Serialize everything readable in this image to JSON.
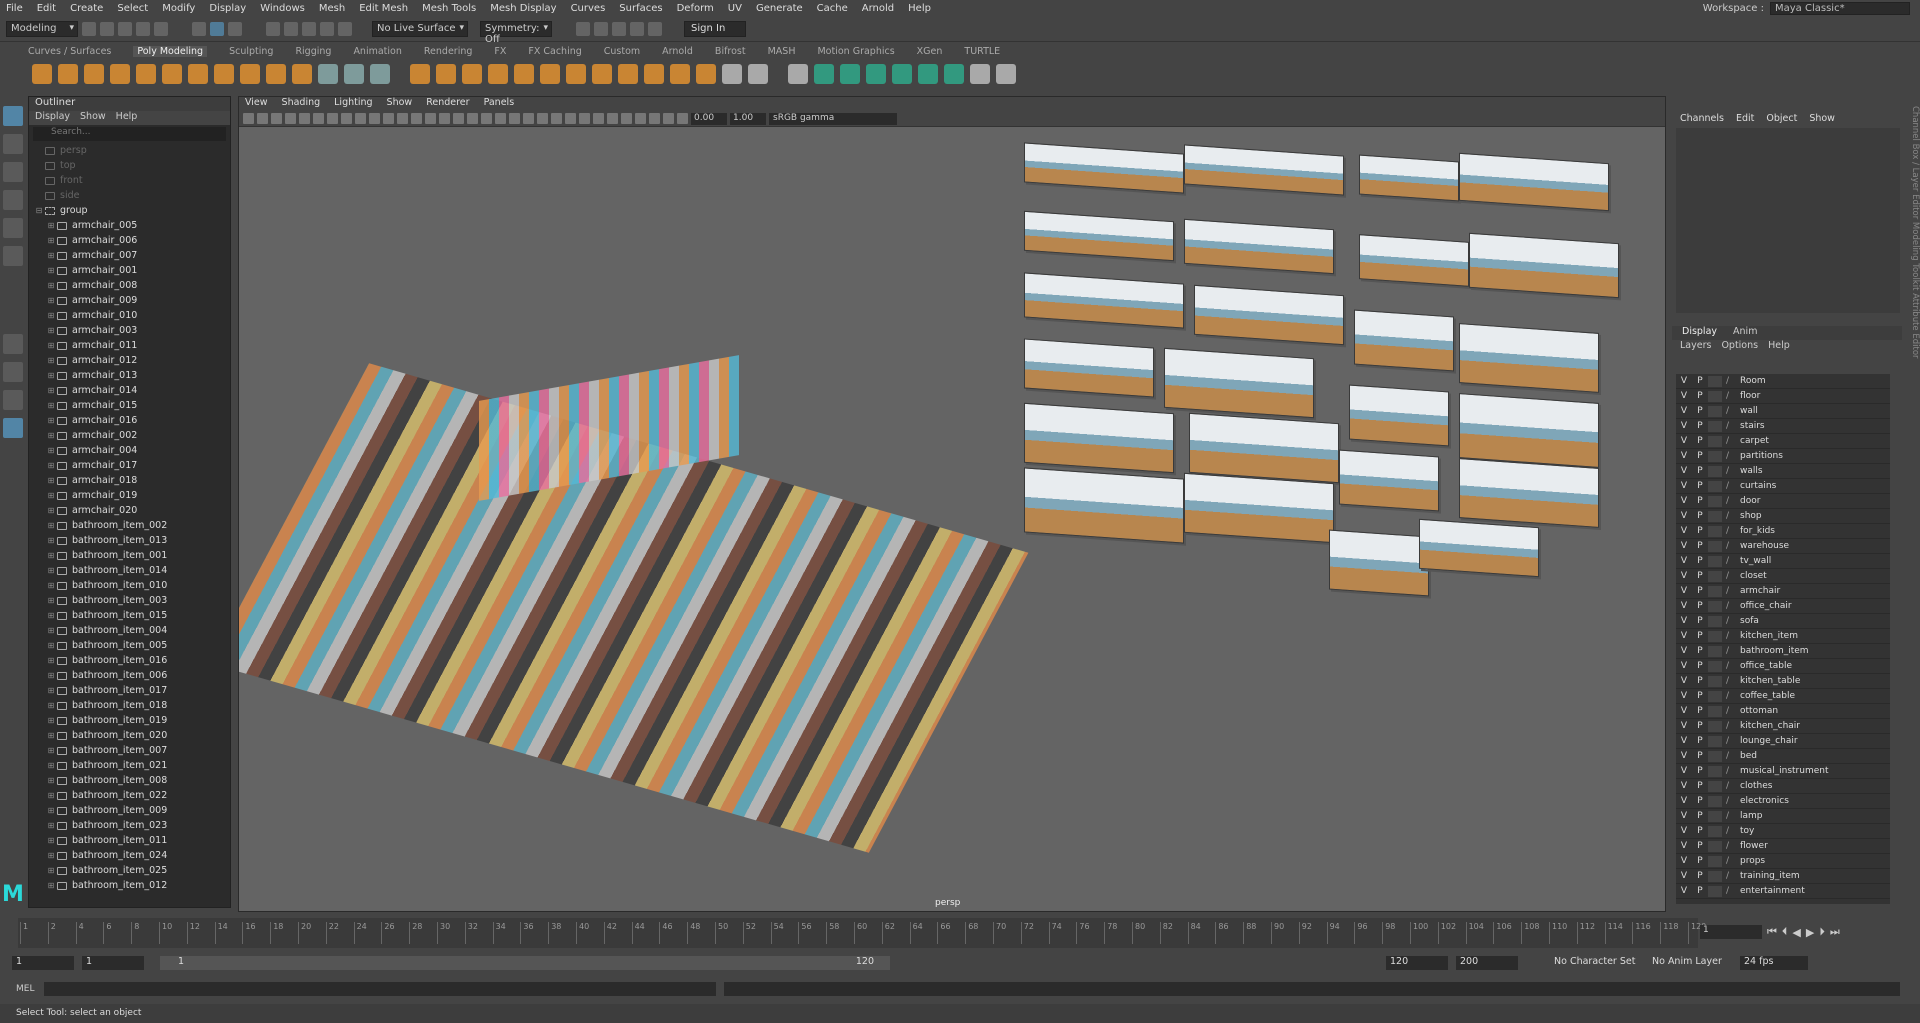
{
  "menubar": [
    "File",
    "Edit",
    "Create",
    "Select",
    "Modify",
    "Display",
    "Windows",
    "Mesh",
    "Edit Mesh",
    "Mesh Tools",
    "Mesh Display",
    "Curves",
    "Surfaces",
    "Deform",
    "UV",
    "Generate",
    "Cache",
    "Arnold",
    "Help"
  ],
  "workspace": {
    "label": "Workspace :",
    "value": "Maya Classic*"
  },
  "status": {
    "mode": "Modeling",
    "live": "No Live Surface",
    "symmetry": "Symmetry: Off",
    "signin": "Sign In"
  },
  "shelf_tabs": [
    "Curves / Surfaces",
    "Poly Modeling",
    "Sculpting",
    "Rigging",
    "Animation",
    "Rendering",
    "FX",
    "FX Caching",
    "Custom",
    "Arnold",
    "Bifrost",
    "MASH",
    "Motion Graphics",
    "XGen",
    "TURTLE"
  ],
  "shelf_active": "Poly Modeling",
  "outliner": {
    "title": "Outliner",
    "menu": [
      "Display",
      "Show",
      "Help"
    ],
    "search": "Search...",
    "cameras": [
      "persp",
      "top",
      "front",
      "side"
    ],
    "group": "group",
    "items": [
      "armchair_005",
      "armchair_006",
      "armchair_007",
      "armchair_001",
      "armchair_008",
      "armchair_009",
      "armchair_010",
      "armchair_003",
      "armchair_011",
      "armchair_012",
      "armchair_013",
      "armchair_014",
      "armchair_015",
      "armchair_016",
      "armchair_002",
      "armchair_004",
      "armchair_017",
      "armchair_018",
      "armchair_019",
      "armchair_020",
      "bathroom_item_002",
      "bathroom_item_013",
      "bathroom_item_001",
      "bathroom_item_014",
      "bathroom_item_010",
      "bathroom_item_003",
      "bathroom_item_015",
      "bathroom_item_004",
      "bathroom_item_005",
      "bathroom_item_016",
      "bathroom_item_006",
      "bathroom_item_017",
      "bathroom_item_018",
      "bathroom_item_019",
      "bathroom_item_020",
      "bathroom_item_007",
      "bathroom_item_021",
      "bathroom_item_008",
      "bathroom_item_022",
      "bathroom_item_009",
      "bathroom_item_023",
      "bathroom_item_011",
      "bathroom_item_024",
      "bathroom_item_025",
      "bathroom_item_012"
    ]
  },
  "viewport": {
    "menu": [
      "View",
      "Shading",
      "Lighting",
      "Show",
      "Renderer",
      "Panels"
    ],
    "exposure": "0.00",
    "gamma": "1.00",
    "colorspace": "sRGB gamma",
    "camera": "persp"
  },
  "channelbox": {
    "menu": [
      "Channels",
      "Edit",
      "Object",
      "Show"
    ]
  },
  "layers": {
    "tabs": [
      "Display",
      "Anim"
    ],
    "menu": [
      "Layers",
      "Options",
      "Help"
    ],
    "names": [
      "Room",
      "floor",
      "wall",
      "stairs",
      "carpet",
      "partitions",
      "walls",
      "curtains",
      "door",
      "shop",
      "for_kids",
      "warehouse",
      "tv_wall",
      "closet",
      "armchair",
      "office_chair",
      "sofa",
      "kitchen_item",
      "bathroom_item",
      "office_table",
      "kitchen_table",
      "coffee_table",
      "ottoman",
      "kitchen_chair",
      "lounge_chair",
      "bed",
      "musical_instrument",
      "clothes",
      "electronics",
      "lamp",
      "toy",
      "flower",
      "props",
      "training_item",
      "entertainment"
    ]
  },
  "vtabs": "Channel Box / Layer Editor   Modeling Toolkit   Attribute Editor",
  "timeline": {
    "ticks": [
      "1",
      "2",
      "4",
      "6",
      "8",
      "10",
      "12",
      "14",
      "16",
      "18",
      "20",
      "22",
      "24",
      "26",
      "28",
      "30",
      "32",
      "34",
      "36",
      "38",
      "40",
      "42",
      "44",
      "46",
      "48",
      "50",
      "52",
      "54",
      "56",
      "58",
      "60",
      "62",
      "64",
      "66",
      "68",
      "70",
      "72",
      "74",
      "76",
      "78",
      "80",
      "82",
      "84",
      "86",
      "88",
      "90",
      "92",
      "94",
      "96",
      "98",
      "100",
      "102",
      "104",
      "106",
      "108",
      "110",
      "112",
      "114",
      "116",
      "118",
      "120"
    ],
    "current": "1"
  },
  "range": {
    "start": "1",
    "pstart": "1",
    "slider_start": "1",
    "slider_end": "120",
    "end": "120",
    "pend": "200",
    "charset": "No Character Set",
    "animlayer": "No Anim Layer",
    "fps": "24 fps"
  },
  "mel": "MEL",
  "help": "Select Tool: select an object"
}
